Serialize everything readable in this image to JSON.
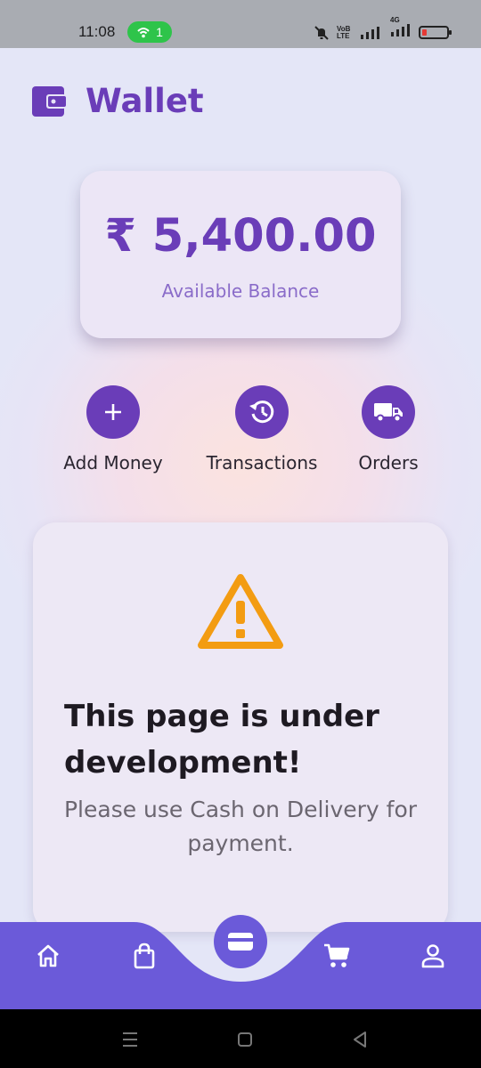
{
  "status_bar": {
    "time": "11:08",
    "hotspot_count": "1",
    "network_label_top": "VoB",
    "network_label_bottom": "LTE",
    "data_type": "4G",
    "battery_level": 0.12
  },
  "header": {
    "title": "Wallet",
    "icon": "wallet-icon"
  },
  "balance": {
    "amount": "₹ 5,400.00",
    "label": "Available Balance"
  },
  "actions": [
    {
      "label": "Add Money",
      "icon": "plus-icon"
    },
    {
      "label": "Transactions",
      "icon": "history-icon"
    },
    {
      "label": "Orders",
      "icon": "truck-icon"
    }
  ],
  "notice": {
    "icon": "warning-icon",
    "title": "This page is under development!",
    "message": "Please use Cash on Delivery for payment."
  },
  "bottom_nav": {
    "items": [
      "home-icon",
      "shopping-bag-icon",
      "wallet-icon",
      "cart-icon",
      "profile-icon"
    ],
    "active": "wallet-icon"
  },
  "colors": {
    "primary": "#6a3db8",
    "nav": "#6b5ad9",
    "warning": "#f39c12",
    "card": "#ece6f6"
  }
}
